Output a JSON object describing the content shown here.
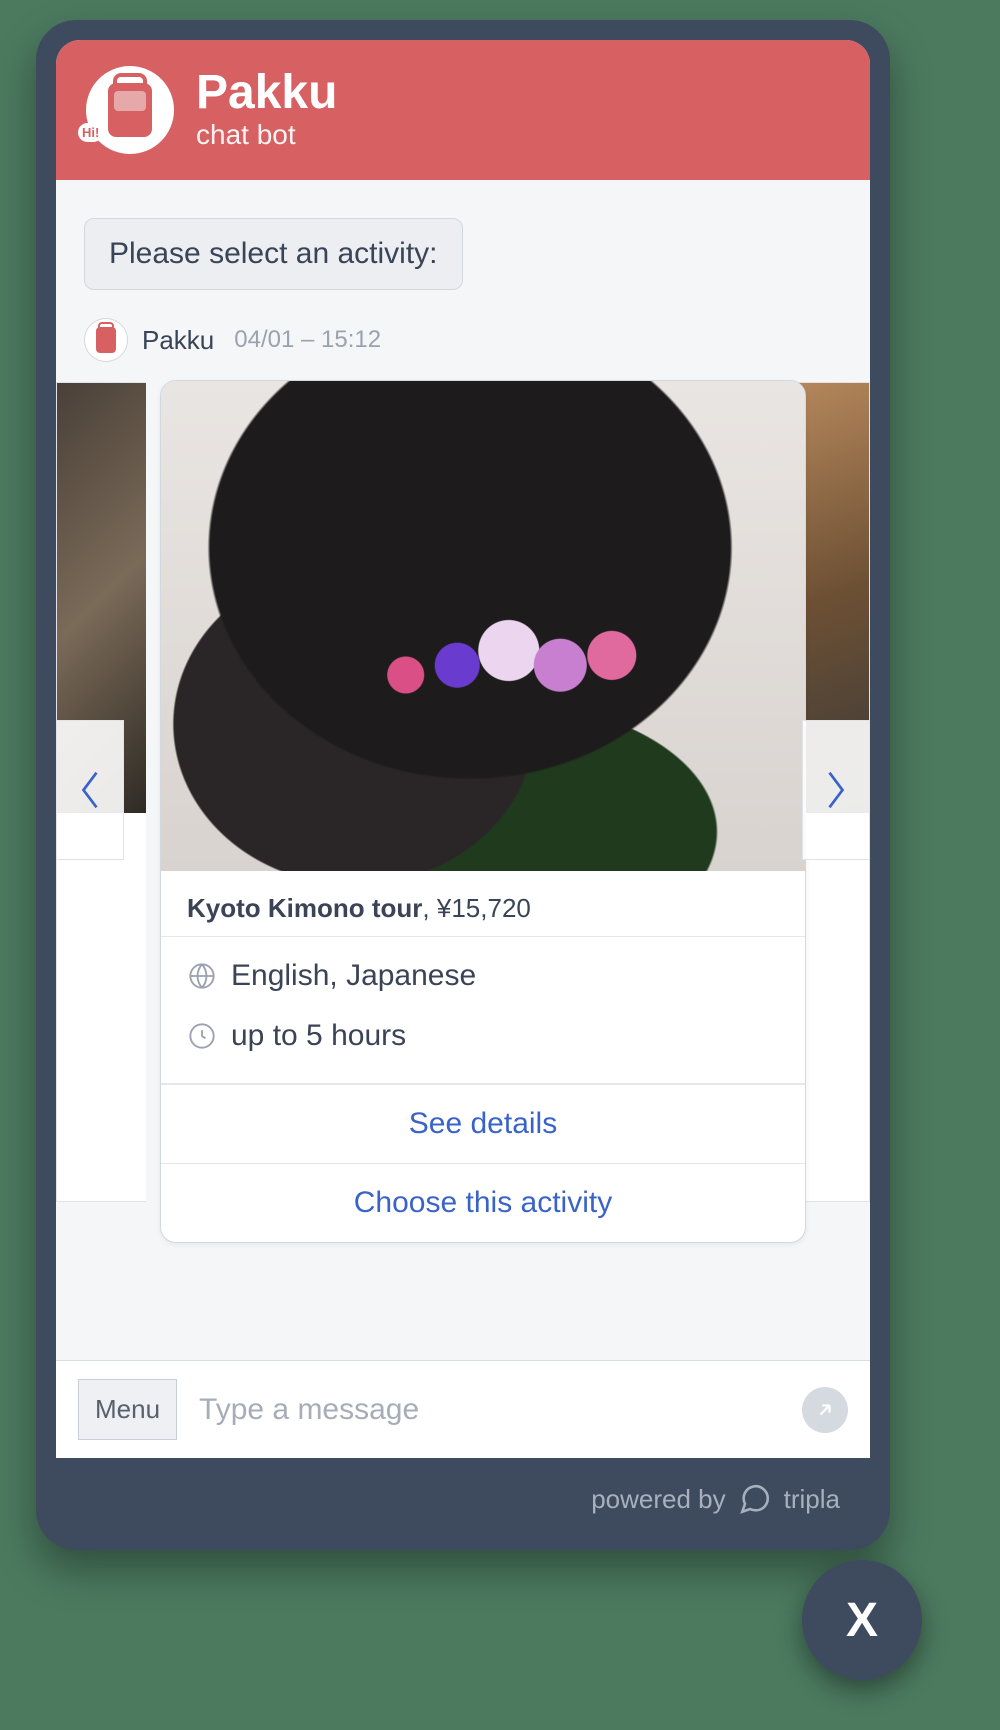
{
  "header": {
    "title": "Pakku",
    "subtitle": "chat bot",
    "hi": "Hi!"
  },
  "system_message": "Please select an activity:",
  "sender": {
    "name": "Pakku",
    "timestamp": "04/01 – 15:12"
  },
  "card": {
    "title": "Kyoto Kimono tour",
    "price": "¥15,720",
    "languages": "English, Japanese",
    "duration": "up to 5 hours",
    "details_label": "See details",
    "choose_label": "Choose this activity"
  },
  "composer": {
    "menu_label": "Menu",
    "placeholder": "Type a message"
  },
  "footer": {
    "powered_by": "powered by",
    "brand": "tripla"
  },
  "close_label": "X"
}
